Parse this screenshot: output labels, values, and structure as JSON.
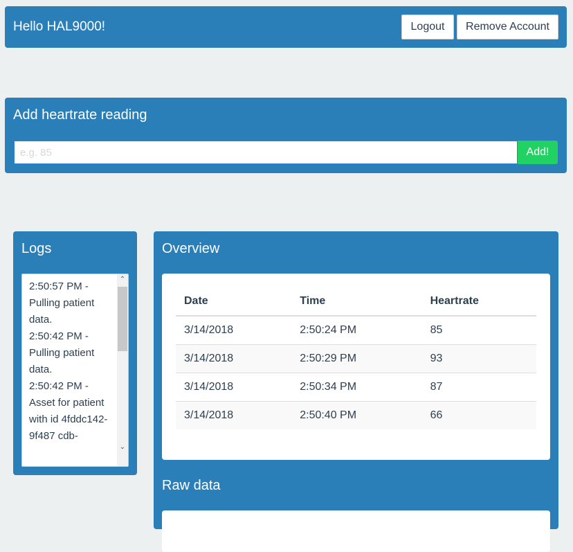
{
  "header": {
    "greeting": "Hello HAL9000!",
    "logout": "Logout",
    "remove_account": "Remove Account"
  },
  "add_reading": {
    "title": "Add heartrate reading",
    "placeholder": "e.g. 85",
    "value": "",
    "add_label": "Add!"
  },
  "logs": {
    "title": "Logs",
    "text": "2:50:57 PM - Pulling patient data.\n2:50:42 PM - Pulling patient data.\n2:50:42 PM - Asset for patient with id 4fddc142-9f487 cdb-"
  },
  "overview": {
    "title": "Overview",
    "columns": [
      "Date",
      "Time",
      "Heartrate"
    ],
    "rows": [
      [
        "3/14/2018",
        "2:50:24 PM",
        "85"
      ],
      [
        "3/14/2018",
        "2:50:29 PM",
        "93"
      ],
      [
        "3/14/2018",
        "2:50:34 PM",
        "87"
      ],
      [
        "3/14/2018",
        "2:50:40 PM",
        "66"
      ]
    ]
  },
  "raw": {
    "title": "Raw data"
  },
  "colors": {
    "panel": "#2a7fb8",
    "background": "#ecf0f1",
    "add_button": "#22d163"
  }
}
